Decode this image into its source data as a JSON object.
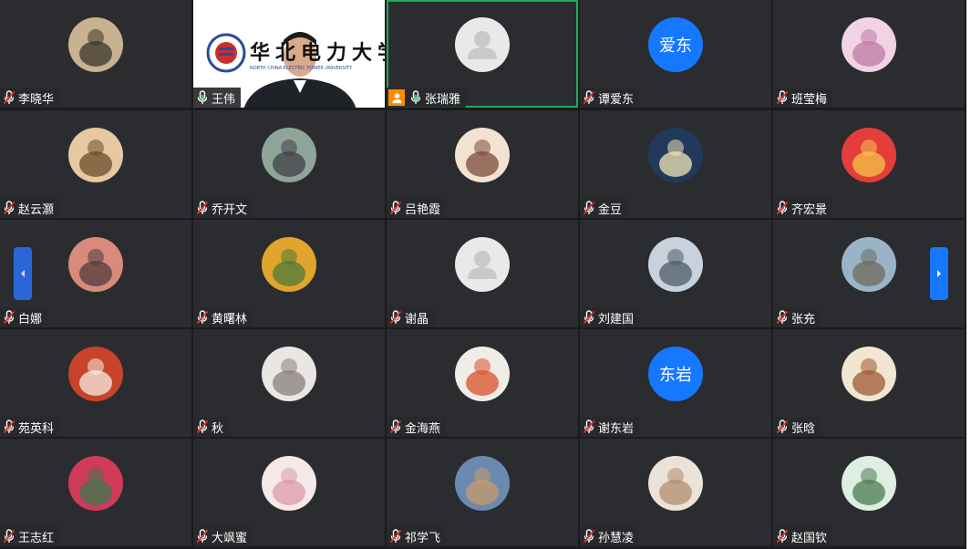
{
  "colors": {
    "tile_bg": "#2b2c30",
    "grid_bg": "#1a1b1e",
    "active_speaker_border": "#1aad5c",
    "accent_blue": "#1677ff",
    "host_badge": "#ff8a00"
  },
  "participants": [
    {
      "name": "李晓华",
      "avatar": "photo",
      "mic": "muted"
    },
    {
      "name": "王伟",
      "avatar": "video",
      "mic": "on",
      "video_banner": {
        "title": "华北电力大学",
        "subtitle": "NORTH CHINA ELECTRIC POWER UNIVERSITY"
      }
    },
    {
      "name": "张瑞雅",
      "avatar": "default",
      "mic": "on",
      "active": true,
      "host_badge": true
    },
    {
      "name": "谭爱东",
      "avatar": "text",
      "avatar_text": "爱东",
      "mic": "muted"
    },
    {
      "name": "班莹梅",
      "avatar": "photo",
      "mic": "muted"
    },
    {
      "name": "赵云灏",
      "avatar": "photo",
      "mic": "muted"
    },
    {
      "name": "乔开文",
      "avatar": "photo",
      "mic": "muted"
    },
    {
      "name": "吕艳霞",
      "avatar": "photo",
      "mic": "muted"
    },
    {
      "name": "金豆",
      "avatar": "photo",
      "mic": "muted"
    },
    {
      "name": "齐宏景",
      "avatar": "photo",
      "mic": "muted"
    },
    {
      "name": "白娜",
      "avatar": "photo",
      "mic": "muted"
    },
    {
      "name": "黄曙林",
      "avatar": "photo",
      "mic": "muted"
    },
    {
      "name": "谢晶",
      "avatar": "default",
      "mic": "muted"
    },
    {
      "name": "刘建国",
      "avatar": "photo",
      "mic": "muted"
    },
    {
      "name": "张充",
      "avatar": "photo",
      "mic": "muted"
    },
    {
      "name": "苑英科",
      "avatar": "photo",
      "mic": "muted"
    },
    {
      "name": "秋",
      "avatar": "photo",
      "mic": "muted"
    },
    {
      "name": "金海燕",
      "avatar": "photo",
      "mic": "muted"
    },
    {
      "name": "谢东岩",
      "avatar": "text",
      "avatar_text": "东岩",
      "mic": "muted"
    },
    {
      "name": "张晗",
      "avatar": "photo",
      "mic": "muted"
    },
    {
      "name": "王志红",
      "avatar": "photo",
      "mic": "muted"
    },
    {
      "name": "大飒蜜",
      "avatar": "photo",
      "mic": "muted"
    },
    {
      "name": "祁学飞",
      "avatar": "photo",
      "mic": "muted"
    },
    {
      "name": "孙慧凌",
      "avatar": "photo",
      "mic": "muted"
    },
    {
      "name": "赵国钦",
      "avatar": "photo",
      "mic": "muted"
    }
  ],
  "navigation": {
    "prev_icon": "chevron-left-icon",
    "next_icon": "chevron-right-icon"
  }
}
